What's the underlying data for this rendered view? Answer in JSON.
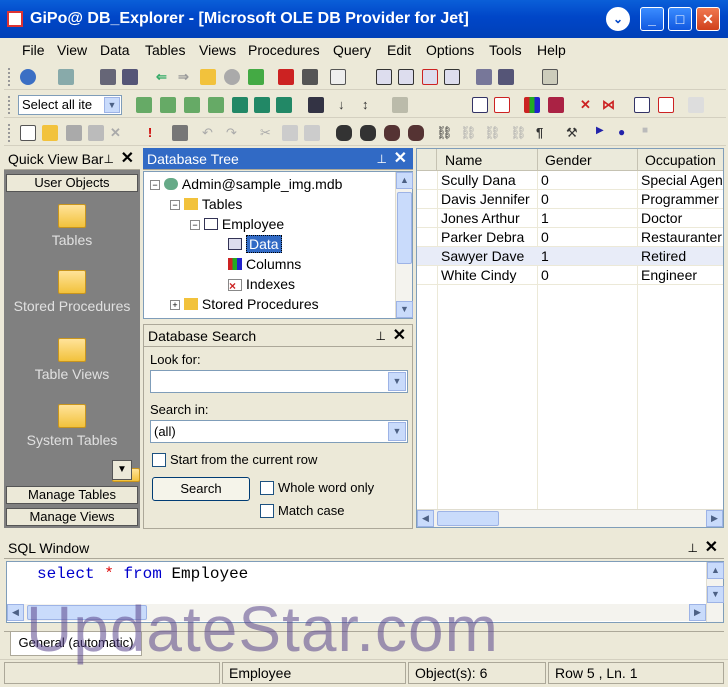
{
  "window": {
    "title": "GiPo@ DB_Explorer - [Microsoft OLE DB Provider for Jet]"
  },
  "menu": [
    "File",
    "View",
    "Data",
    "Tables",
    "Views",
    "Procedures",
    "Query",
    "Edit",
    "Options",
    "Tools",
    "Help"
  ],
  "toolbar": {
    "select_combo": "Select all ite"
  },
  "quick_view": {
    "title": "Quick View Bar",
    "top_button": "User Objects",
    "items": [
      "Tables",
      "Stored Procedures",
      "Table Views",
      "System Tables"
    ],
    "bottom_buttons": [
      "Manage Tables",
      "Manage Views"
    ]
  },
  "tree": {
    "title": "Database Tree",
    "root": "Admin@sample_img.mdb",
    "tables": "Tables",
    "table": "Employee",
    "children": [
      "Data",
      "Columns",
      "Indexes"
    ],
    "procs": "Stored Procedures"
  },
  "search": {
    "title": "Database Search",
    "look_for_label": "Look for:",
    "look_for_value": "",
    "search_in_label": "Search in:",
    "search_in_value": "(all)",
    "start_current": "Start from the current row",
    "search_button": "Search",
    "whole_word": "Whole word only",
    "match_case": "Match case"
  },
  "grid": {
    "columns": [
      "Name",
      "Gender",
      "Occupation"
    ],
    "rows": [
      [
        "Scully Dana",
        "0",
        "Special Agen"
      ],
      [
        "Davis Jennifer",
        "0",
        "Programmer"
      ],
      [
        "Jones Arthur",
        "1",
        "Doctor"
      ],
      [
        "Parker Debra",
        "0",
        "Restauranter"
      ],
      [
        "Sawyer Dave",
        "1",
        "Retired"
      ],
      [
        "White Cindy",
        "0",
        "Engineer"
      ]
    ],
    "selected_row": 4
  },
  "sql": {
    "title": "SQL Window",
    "kw1": "select",
    "star": "*",
    "kw2": "from",
    "table": "Employee",
    "tab": "General (automatic)"
  },
  "status": {
    "table": "Employee",
    "objects": "Object(s): 6",
    "position": "Row 5 , Ln. 1"
  },
  "watermark": "UpdateStar.com",
  "colors": {
    "title_bar": "#0046c8",
    "selection": "#316ac5",
    "keyword": "#0000cc",
    "sidebar_bg": "#808080"
  }
}
